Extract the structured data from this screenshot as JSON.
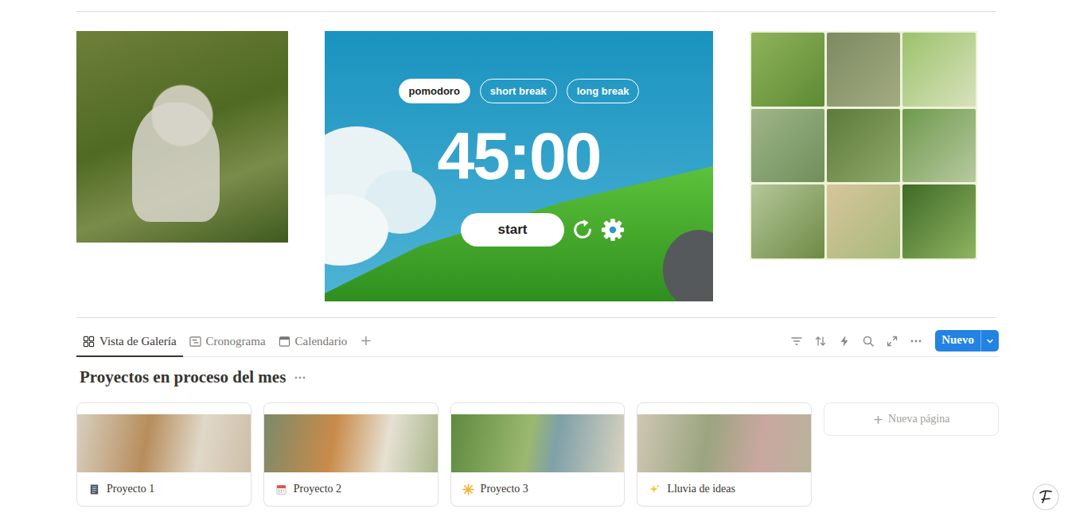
{
  "pomodoro": {
    "modes": [
      {
        "label": "pomodoro",
        "selected": true
      },
      {
        "label": "short break",
        "selected": false
      },
      {
        "label": "long break",
        "selected": false
      }
    ],
    "time": "45:00",
    "start_label": "start"
  },
  "database": {
    "views": [
      {
        "label": "Vista de Galería",
        "selected": true,
        "kind": "gallery"
      },
      {
        "label": "Cronograma",
        "selected": false,
        "kind": "timeline"
      },
      {
        "label": "Calendario",
        "selected": false,
        "kind": "calendar"
      }
    ],
    "add_view": "+",
    "new_button": "Nuevo",
    "title": "Proyectos en proceso del mes",
    "cards": [
      {
        "title": "Proyecto 1",
        "kind": "notepad"
      },
      {
        "title": "Proyecto 2",
        "kind": "calendar"
      },
      {
        "title": "Proyecto 3",
        "kind": "sun"
      },
      {
        "title": "Lluvia de ideas",
        "kind": "sparkles"
      }
    ],
    "new_page": {
      "symbol": "+",
      "label": "Nueva página"
    }
  }
}
